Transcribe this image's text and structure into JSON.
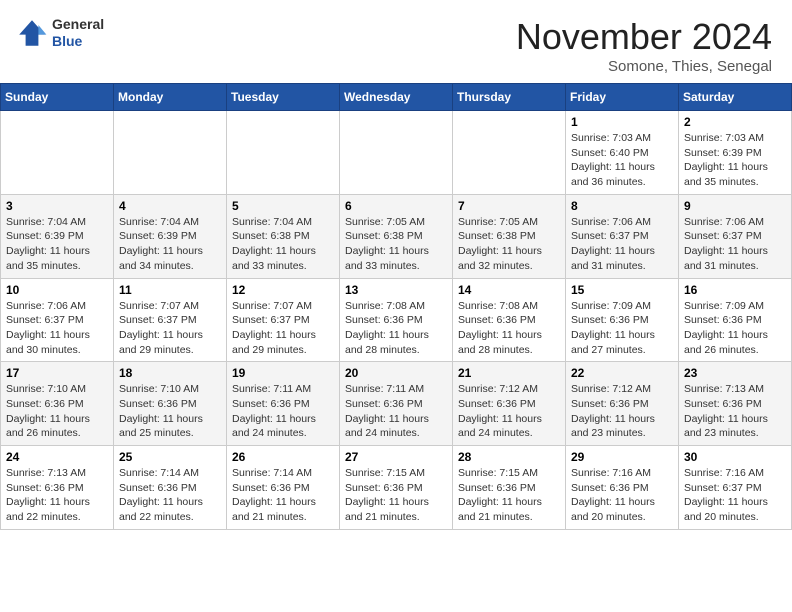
{
  "header": {
    "logo_line1": "General",
    "logo_line2": "Blue",
    "month": "November 2024",
    "location": "Somone, Thies, Senegal"
  },
  "weekdays": [
    "Sunday",
    "Monday",
    "Tuesday",
    "Wednesday",
    "Thursday",
    "Friday",
    "Saturday"
  ],
  "weeks": [
    [
      {
        "day": "",
        "info": ""
      },
      {
        "day": "",
        "info": ""
      },
      {
        "day": "",
        "info": ""
      },
      {
        "day": "",
        "info": ""
      },
      {
        "day": "",
        "info": ""
      },
      {
        "day": "1",
        "info": "Sunrise: 7:03 AM\nSunset: 6:40 PM\nDaylight: 11 hours and 36 minutes."
      },
      {
        "day": "2",
        "info": "Sunrise: 7:03 AM\nSunset: 6:39 PM\nDaylight: 11 hours and 35 minutes."
      }
    ],
    [
      {
        "day": "3",
        "info": "Sunrise: 7:04 AM\nSunset: 6:39 PM\nDaylight: 11 hours and 35 minutes."
      },
      {
        "day": "4",
        "info": "Sunrise: 7:04 AM\nSunset: 6:39 PM\nDaylight: 11 hours and 34 minutes."
      },
      {
        "day": "5",
        "info": "Sunrise: 7:04 AM\nSunset: 6:38 PM\nDaylight: 11 hours and 33 minutes."
      },
      {
        "day": "6",
        "info": "Sunrise: 7:05 AM\nSunset: 6:38 PM\nDaylight: 11 hours and 33 minutes."
      },
      {
        "day": "7",
        "info": "Sunrise: 7:05 AM\nSunset: 6:38 PM\nDaylight: 11 hours and 32 minutes."
      },
      {
        "day": "8",
        "info": "Sunrise: 7:06 AM\nSunset: 6:37 PM\nDaylight: 11 hours and 31 minutes."
      },
      {
        "day": "9",
        "info": "Sunrise: 7:06 AM\nSunset: 6:37 PM\nDaylight: 11 hours and 31 minutes."
      }
    ],
    [
      {
        "day": "10",
        "info": "Sunrise: 7:06 AM\nSunset: 6:37 PM\nDaylight: 11 hours and 30 minutes."
      },
      {
        "day": "11",
        "info": "Sunrise: 7:07 AM\nSunset: 6:37 PM\nDaylight: 11 hours and 29 minutes."
      },
      {
        "day": "12",
        "info": "Sunrise: 7:07 AM\nSunset: 6:37 PM\nDaylight: 11 hours and 29 minutes."
      },
      {
        "day": "13",
        "info": "Sunrise: 7:08 AM\nSunset: 6:36 PM\nDaylight: 11 hours and 28 minutes."
      },
      {
        "day": "14",
        "info": "Sunrise: 7:08 AM\nSunset: 6:36 PM\nDaylight: 11 hours and 28 minutes."
      },
      {
        "day": "15",
        "info": "Sunrise: 7:09 AM\nSunset: 6:36 PM\nDaylight: 11 hours and 27 minutes."
      },
      {
        "day": "16",
        "info": "Sunrise: 7:09 AM\nSunset: 6:36 PM\nDaylight: 11 hours and 26 minutes."
      }
    ],
    [
      {
        "day": "17",
        "info": "Sunrise: 7:10 AM\nSunset: 6:36 PM\nDaylight: 11 hours and 26 minutes."
      },
      {
        "day": "18",
        "info": "Sunrise: 7:10 AM\nSunset: 6:36 PM\nDaylight: 11 hours and 25 minutes."
      },
      {
        "day": "19",
        "info": "Sunrise: 7:11 AM\nSunset: 6:36 PM\nDaylight: 11 hours and 24 minutes."
      },
      {
        "day": "20",
        "info": "Sunrise: 7:11 AM\nSunset: 6:36 PM\nDaylight: 11 hours and 24 minutes."
      },
      {
        "day": "21",
        "info": "Sunrise: 7:12 AM\nSunset: 6:36 PM\nDaylight: 11 hours and 24 minutes."
      },
      {
        "day": "22",
        "info": "Sunrise: 7:12 AM\nSunset: 6:36 PM\nDaylight: 11 hours and 23 minutes."
      },
      {
        "day": "23",
        "info": "Sunrise: 7:13 AM\nSunset: 6:36 PM\nDaylight: 11 hours and 23 minutes."
      }
    ],
    [
      {
        "day": "24",
        "info": "Sunrise: 7:13 AM\nSunset: 6:36 PM\nDaylight: 11 hours and 22 minutes."
      },
      {
        "day": "25",
        "info": "Sunrise: 7:14 AM\nSunset: 6:36 PM\nDaylight: 11 hours and 22 minutes."
      },
      {
        "day": "26",
        "info": "Sunrise: 7:14 AM\nSunset: 6:36 PM\nDaylight: 11 hours and 21 minutes."
      },
      {
        "day": "27",
        "info": "Sunrise: 7:15 AM\nSunset: 6:36 PM\nDaylight: 11 hours and 21 minutes."
      },
      {
        "day": "28",
        "info": "Sunrise: 7:15 AM\nSunset: 6:36 PM\nDaylight: 11 hours and 21 minutes."
      },
      {
        "day": "29",
        "info": "Sunrise: 7:16 AM\nSunset: 6:36 PM\nDaylight: 11 hours and 20 minutes."
      },
      {
        "day": "30",
        "info": "Sunrise: 7:16 AM\nSunset: 6:37 PM\nDaylight: 11 hours and 20 minutes."
      }
    ]
  ]
}
